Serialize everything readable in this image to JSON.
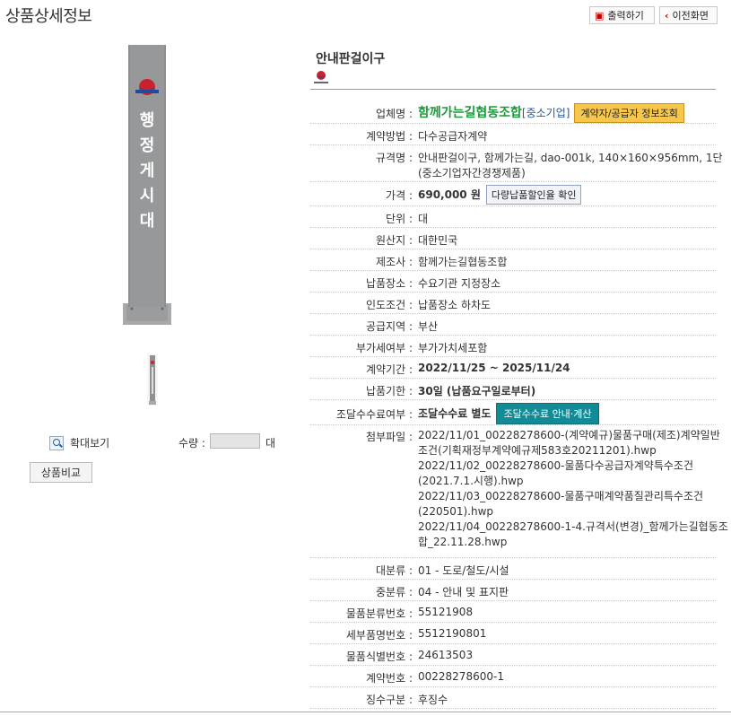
{
  "page_title": "상품상세정보",
  "toolbar": {
    "print_label": "출력하기",
    "back_label": "이전화면"
  },
  "image_area": {
    "sign_text": "행정게시대",
    "zoom_label": "확대보기",
    "quantity_label": "수량 :",
    "quantity_value": "",
    "quantity_unit": "대",
    "compare_label": "상품비교"
  },
  "product": {
    "name": "안내판걸이구",
    "fields": [
      {
        "label": "업체명 :",
        "company": "함께가는길협동조합",
        "company_tag": "[중소기업]",
        "button": "계약자/공급자 정보조회"
      },
      {
        "label": "계약방법 :",
        "value": "다수공급자계약"
      },
      {
        "label": "규격명 :",
        "value": "안내판걸이구, 함께가는길, dao-001k, 140×160×956mm, 1단",
        "extra": "(중소기업자간경쟁제품)"
      },
      {
        "label": "가격 :",
        "value": "690,000 원",
        "button": "다량납품할인율 확인"
      },
      {
        "label": "단위 :",
        "value": "대"
      },
      {
        "label": "원산지 :",
        "value": "대한민국"
      },
      {
        "label": "제조사 :",
        "value": "함께가는길협동조합"
      },
      {
        "label": "납품장소 :",
        "value": "수요기관 지정장소"
      },
      {
        "label": "인도조건 :",
        "value": "납품장소 하차도"
      },
      {
        "label": "공급지역 :",
        "value": "부산"
      },
      {
        "label": "부가세여부 :",
        "value": "부가가치세포함"
      },
      {
        "label": "계약기간 :",
        "value": "2022/11/25 ~ 2025/11/24"
      },
      {
        "label": "납품기한 :",
        "value": "30일 (납품요구일로부터)"
      },
      {
        "label": "조달수수료여부 :",
        "value": "조달수수료 별도",
        "button": "조달수수료 안내·계산"
      },
      {
        "label": "첨부파일 :",
        "files": [
          "2022/11/01_00228278600-(계약예규)물품구매(제조)계약일반",
          "조건(기획재정부계약예규제583호20211201).hwp",
          "2022/11/02_00228278600-물품다수공급자계약특수조건",
          "(2021.7.1.시행).hwp",
          "2022/11/03_00228278600-물품구매계약품질관리특수조건",
          "(220501).hwp",
          "2022/11/04_00228278600-1-4.규격서(변경)_함께가는길협동조",
          "합_22.11.28.hwp"
        ]
      },
      {
        "label": "대분류 :",
        "value": "01 - 도로/철도/시설"
      },
      {
        "label": "중분류 :",
        "value": "04 - 안내 및 표지판"
      },
      {
        "label": "물품분류번호 :",
        "value": "55121908"
      },
      {
        "label": "세부품명번호 :",
        "value": "5512190801"
      },
      {
        "label": "물품식별번호 :",
        "value": "24613503"
      },
      {
        "label": "계약번호 :",
        "value": "00228278600-1"
      },
      {
        "label": "징수구분 :",
        "value": "후징수"
      }
    ]
  }
}
